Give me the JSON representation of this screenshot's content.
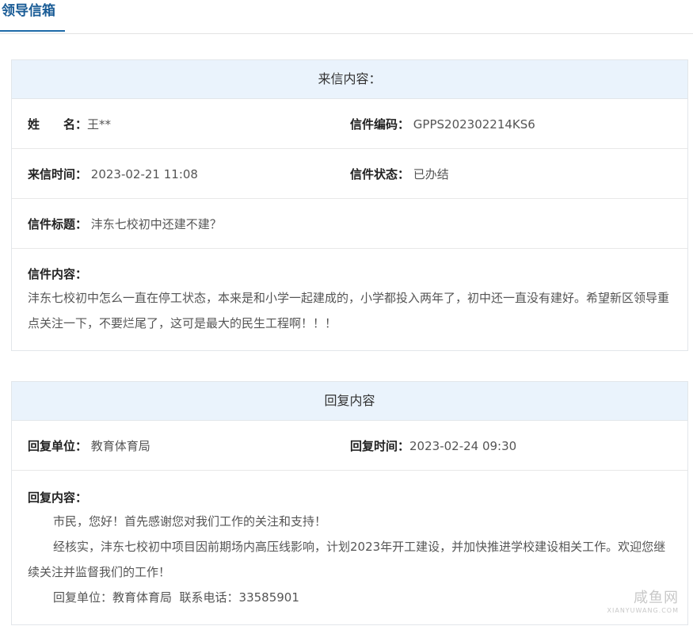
{
  "tabs": {
    "active": "领导信箱"
  },
  "letter": {
    "header": "来信内容：",
    "name_label": "姓　　名：",
    "name_value": "王**",
    "code_label": "信件编码：",
    "code_value": "GPPS202302214KS6",
    "time_label": "来信时间：",
    "time_value": "2023-02-21 11:08",
    "status_label": "信件状态：",
    "status_value": "已办结",
    "title_label": "信件标题：",
    "title_value": "沣东七校初中还建不建？",
    "content_label": "信件内容：",
    "content_value": "沣东七校初中怎么一直在停工状态，本来是和小学一起建成的，小学都投入两年了，初中还一直没有建好。希望新区领导重点关注一下，不要烂尾了，这可是最大的民生工程啊！！！"
  },
  "reply": {
    "header": "回复内容",
    "unit_label": "回复单位：",
    "unit_value": "教育体育局",
    "time_label": "回复时间：",
    "time_value": "2023-02-24 09:30",
    "content_label": "回复内容：",
    "paragraphs": [
      "市民，您好！首先感谢您对我们工作的关注和支持！",
      "经核实，沣东七校初中项目因前期场内高压线影响，计划2023年开工建设，并加快推进学校建设相关工作。欢迎您继续关注并监督我们的工作！",
      "回复单位：教育体育局  联系电话：33585901"
    ]
  },
  "watermark": {
    "main": "咸鱼网",
    "sub": "XIANYUWANG.COM"
  }
}
